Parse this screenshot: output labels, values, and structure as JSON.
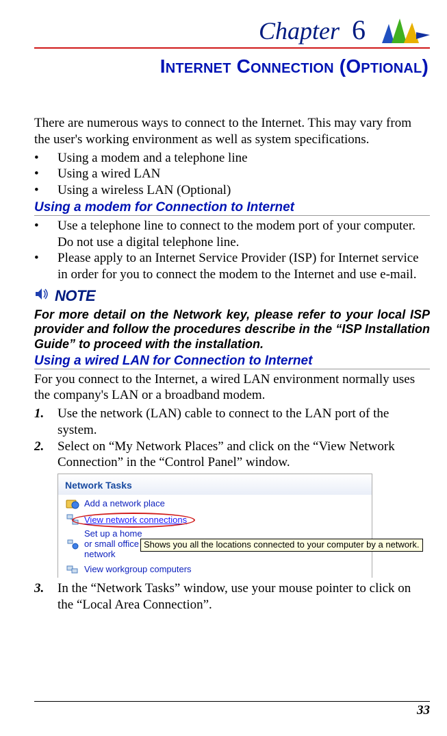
{
  "chapter": {
    "label": "Chapter",
    "num": "6"
  },
  "title": "Internet Connection (Optional)",
  "intro": "There are numerous ways to connect to the Internet. This may vary from the user's working environment as well as system specifications.",
  "intro_bullets": [
    "Using a modem and a telephone line",
    "Using a wired LAN",
    "Using a wireless LAN (Optional)"
  ],
  "section1": {
    "heading": "Using a modem for Connection to Internet",
    "bullets": [
      "Use a telephone line to connect to the modem port of your computer. Do not use a digital telephone line.",
      "Please apply to an Internet Service Provider (ISP) for Internet service in order for you to connect the modem to the Internet and use e-mail."
    ]
  },
  "note": {
    "label": "NOTE",
    "text": "For more detail on the Network key, please refer to your local ISP provider and follow the procedures describe in the “ISP Installation Guide” to proceed with the installation."
  },
  "section2": {
    "heading": "Using a wired LAN for Connection to Internet",
    "intro": "For you connect to the Internet, a wired LAN environment normally uses the company's LAN or a broadband modem.",
    "steps": [
      {
        "n": "1.",
        "text": "Use the network (LAN) cable to connect to the LAN port of the system."
      },
      {
        "n": "2.",
        "text": "Select on “My Network Places” and click on the “View Network Connection” in the “Control Panel” window."
      },
      {
        "n": "3.",
        "text": "In the “Network Tasks” window, use your mouse pointer to click on the “Local Area Connection”."
      }
    ]
  },
  "network_tasks": {
    "title": "Network Tasks",
    "items": [
      "Add a network place",
      "View network connections",
      "Set up a home or small office network",
      "View workgroup computers"
    ],
    "tooltip": "Shows you all the locations connected to your computer by a network."
  },
  "page_number": "33"
}
